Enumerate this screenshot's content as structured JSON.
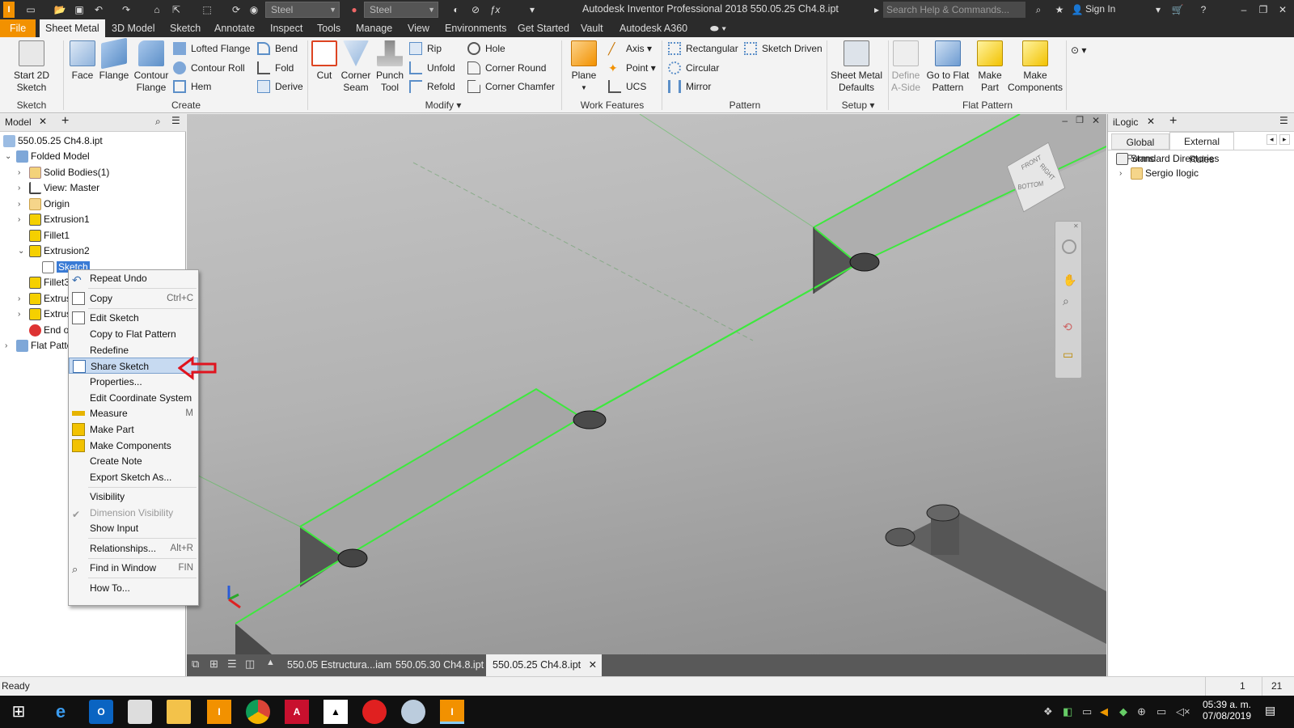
{
  "titlebar": {
    "material": "Steel",
    "appearance": "Steel",
    "title": "Autodesk Inventor Professional 2018    550.05.25 Ch4.8.ipt",
    "search_placeholder": "Search Help & Commands...",
    "signin": "Sign In"
  },
  "tabs": [
    "File",
    "Sheet Metal",
    "3D Model",
    "Sketch",
    "Annotate",
    "Inspect",
    "Tools",
    "Manage",
    "View",
    "Environments",
    "Get Started",
    "Vault",
    "Autodesk A360"
  ],
  "ribbon": {
    "sketch": {
      "start": "Start 2D Sketch",
      "group": "Sketch"
    },
    "create": {
      "face": "Face",
      "flange": "Flange",
      "contour_flange": "Contour Flange",
      "lofted_flange": "Lofted Flange",
      "contour_roll": "Contour Roll",
      "hem": "Hem",
      "bend": "Bend",
      "fold": "Fold",
      "derive": "Derive",
      "group": "Create"
    },
    "modify": {
      "cut": "Cut",
      "corner_seam": "Corner Seam",
      "punch_tool": "Punch Tool",
      "rip": "Rip",
      "unfold": "Unfold",
      "refold": "Refold",
      "hole": "Hole",
      "corner_round": "Corner Round",
      "corner_chamfer": "Corner Chamfer",
      "group": "Modify"
    },
    "work": {
      "plane": "Plane",
      "axis": "Axis",
      "point": "Point",
      "ucs": "UCS",
      "group": "Work Features"
    },
    "pattern": {
      "rectangular": "Rectangular",
      "sketch_driven": "Sketch Driven",
      "circular": "Circular",
      "mirror": "Mirror",
      "group": "Pattern"
    },
    "setup": {
      "defaults": "Sheet Metal Defaults",
      "group": "Setup"
    },
    "flat": {
      "define_a_side": "Define A-Side",
      "go_to_flat": "Go to Flat Pattern",
      "make_part": "Make Part",
      "make_components": "Make Components",
      "group": "Flat Pattern"
    }
  },
  "browser": {
    "title": "Model",
    "items": [
      {
        "label": "550.05.25 Ch4.8.ipt"
      },
      {
        "label": "Folded Model"
      },
      {
        "label": "Solid Bodies(1)"
      },
      {
        "label": "View: Master"
      },
      {
        "label": "Origin"
      },
      {
        "label": "Extrusion1"
      },
      {
        "label": "Fillet1"
      },
      {
        "label": "Extrusion2"
      },
      {
        "label": "Sketch"
      },
      {
        "label": "Fillet3"
      },
      {
        "label": "Extrus"
      },
      {
        "label": "Extrus"
      },
      {
        "label": "End of"
      },
      {
        "label": "Flat Patte"
      }
    ]
  },
  "context_menu": [
    {
      "label": "Repeat Undo",
      "shortcut": ""
    },
    {
      "label": "Copy",
      "shortcut": "Ctrl+C"
    },
    {
      "label": "Edit Sketch",
      "shortcut": ""
    },
    {
      "label": "Copy to Flat Pattern",
      "shortcut": ""
    },
    {
      "label": "Redefine",
      "shortcut": ""
    },
    {
      "label": "Share Sketch",
      "shortcut": ""
    },
    {
      "label": "Properties...",
      "shortcut": ""
    },
    {
      "label": "Edit Coordinate System",
      "shortcut": ""
    },
    {
      "label": "Measure",
      "shortcut": "M"
    },
    {
      "label": "Make Part",
      "shortcut": ""
    },
    {
      "label": "Make Components",
      "shortcut": ""
    },
    {
      "label": "Create Note",
      "shortcut": ""
    },
    {
      "label": "Export Sketch As...",
      "shortcut": ""
    },
    {
      "label": "Visibility",
      "shortcut": ""
    },
    {
      "label": "Dimension Visibility",
      "shortcut": ""
    },
    {
      "label": "Show Input",
      "shortcut": ""
    },
    {
      "label": "Relationships...",
      "shortcut": "Alt+R"
    },
    {
      "label": "Find in Window",
      "shortcut": "FIN"
    },
    {
      "label": "How To...",
      "shortcut": ""
    }
  ],
  "viewcube": {
    "front": "FRONT",
    "right": "RIGHT",
    "bottom": "BOTTOM"
  },
  "doc_tabs": [
    "550.05 Estructura...iam",
    "550.05.30 Ch4.8.ipt",
    "550.05.25 Ch4.8.ipt"
  ],
  "ilogic": {
    "title": "iLogic",
    "tabs": [
      "Global Forms",
      "External Rules"
    ],
    "items": [
      "Standard Directories",
      "Sergio Ilogic"
    ]
  },
  "status": {
    "text": "Ready",
    "count1": "1",
    "count2": "21"
  },
  "clock": {
    "time": "05:39 a. m.",
    "date": "07/08/2019"
  },
  "colors": {
    "accent": "#f29100",
    "edge_highlight": "#3ee83e",
    "menu_highlight": "#c7daf1",
    "arrow": "#e0141e"
  }
}
